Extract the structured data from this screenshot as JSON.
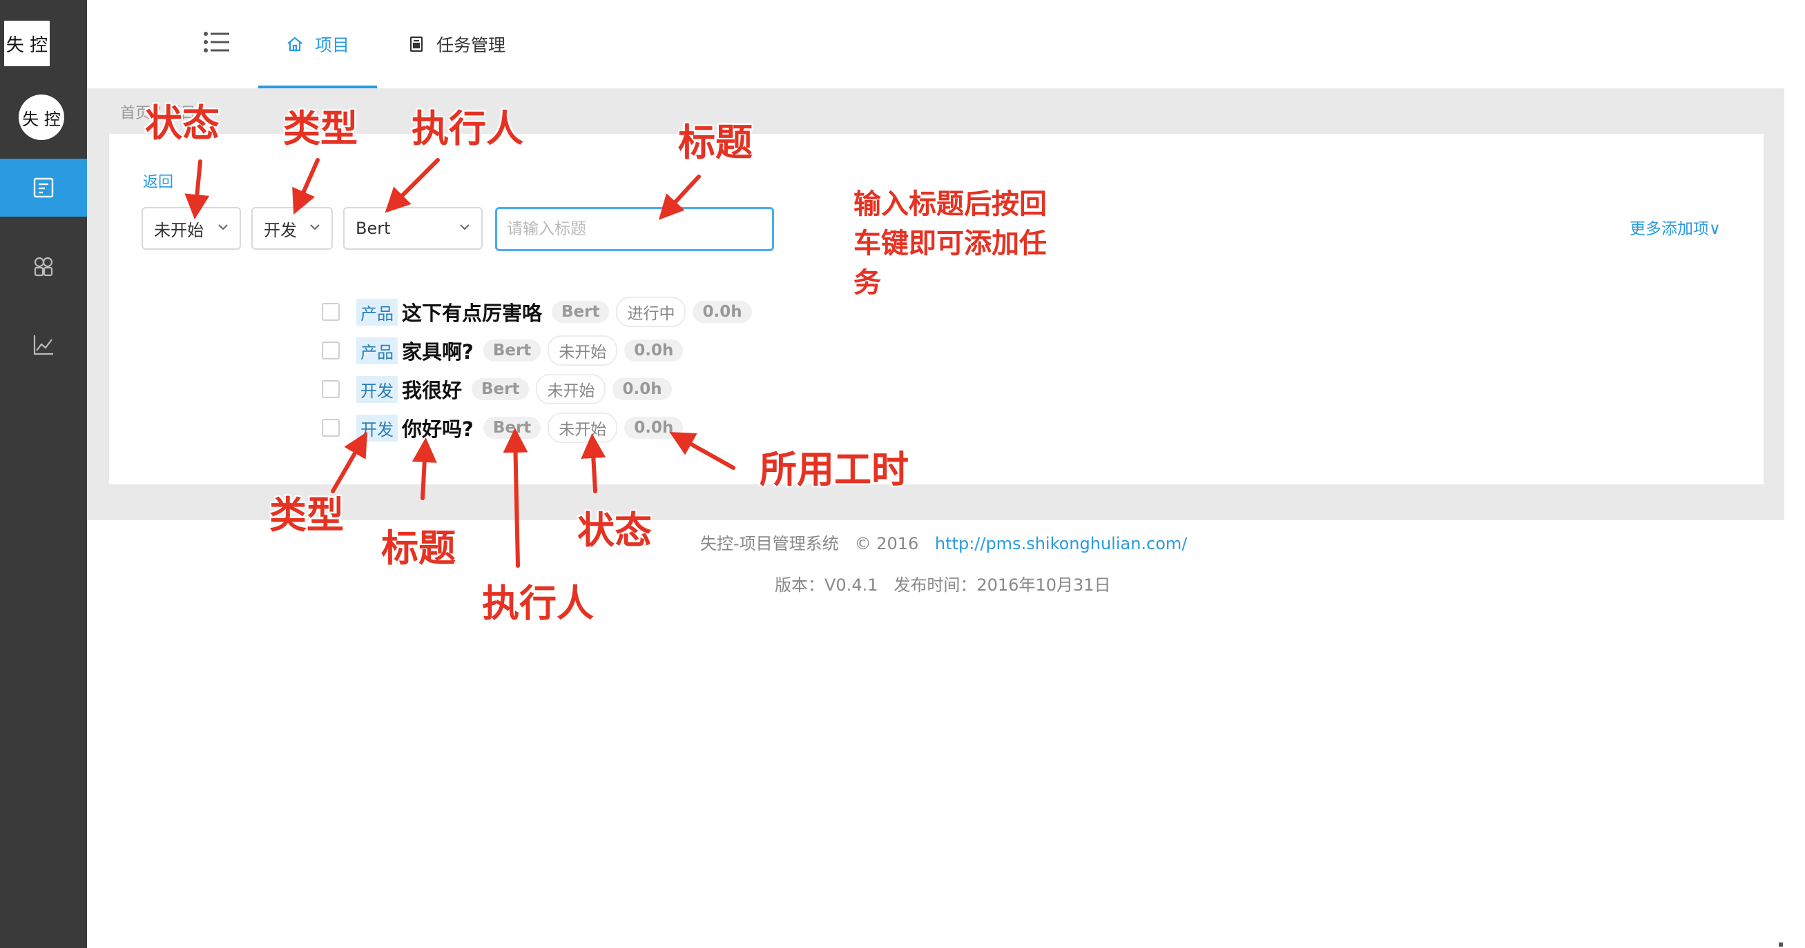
{
  "sidebar": {
    "logo_text": "失 控",
    "avatar_text": "失 控",
    "items": [
      {
        "icon": "task-list-icon",
        "active": true
      },
      {
        "icon": "modules-icon",
        "active": false
      },
      {
        "icon": "chart-line-icon",
        "active": false
      }
    ],
    "active_color": "#2a9be0"
  },
  "header": {
    "menu_icon": "list-menu-icon",
    "tabs": [
      {
        "label": "项目",
        "icon": "home-icon",
        "active": true
      },
      {
        "label": "任务管理",
        "icon": "document-icon",
        "active": false
      }
    ]
  },
  "breadcrumb": {
    "home": "首页",
    "current": "项目"
  },
  "form": {
    "back_label": "返回",
    "status_value": "未开始",
    "type_value": "开发",
    "assignee_value": "Bert",
    "title_placeholder": "请输入标题",
    "more_label": "更多添加项"
  },
  "tasks": [
    {
      "type": "产品",
      "title": "这下有点厉害咯",
      "assignee": "Bert",
      "status": "进行中",
      "hours": "0.0h"
    },
    {
      "type": "产品",
      "title": "家具啊?",
      "assignee": "Bert",
      "status": "未开始",
      "hours": "0.0h"
    },
    {
      "type": "开发",
      "title": "我很好",
      "assignee": "Bert",
      "status": "未开始",
      "hours": "0.0h"
    },
    {
      "type": "开发",
      "title": "你好吗?",
      "assignee": "Bert",
      "status": "未开始",
      "hours": "0.0h"
    }
  ],
  "footer": {
    "system": "失控-项目管理系统",
    "copyright": "© 2016",
    "url": "http://pms.shikonghulian.com/",
    "version_line": "版本：V0.4.1   发布时间：2016年10月31日"
  },
  "annotations": {
    "status_top": "状态",
    "type_top": "类型",
    "assignee_top": "执行人",
    "title_top": "标题",
    "enter_hint": "输入标题后按回车键即可添加任务",
    "hours": "所用工时",
    "type_bottom": "类型",
    "title_bottom": "标题",
    "status_bottom": "状态",
    "assignee_bottom": "执行人"
  },
  "colors": {
    "accent": "#2a9be0",
    "annotation": "#e53222",
    "sidebar": "#3a3a3a"
  }
}
